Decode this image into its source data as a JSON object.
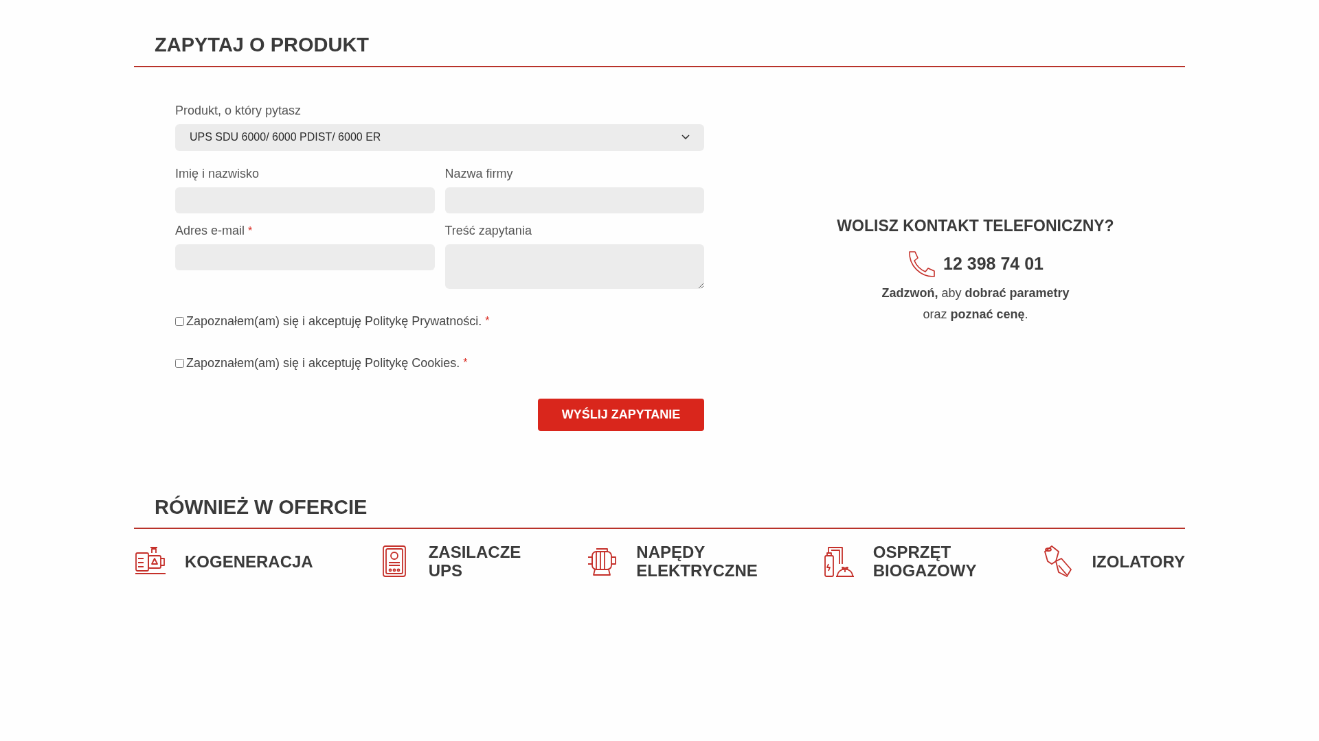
{
  "inquiry": {
    "title": "ZAPYTAJ O PRODUKT",
    "product_select": {
      "label": "Produkt, o który pytasz",
      "value": "UPS SDU 6000/ 6000 PDIST/ 6000 ER"
    },
    "fields": [
      {
        "kind": "input",
        "label": "Imię i nazwisko",
        "required": false
      },
      {
        "kind": "input",
        "label": "Nazwa firmy",
        "required": false
      },
      {
        "kind": "input",
        "label": "Adres e-mail",
        "required": true
      },
      {
        "kind": "textarea",
        "label": "Treść zapytania",
        "required": false
      }
    ],
    "required_mark": "*",
    "consents": [
      {
        "label": "Zapoznałem(am) się i akceptuję Politykę Prywatności.",
        "checked": false,
        "required": true
      },
      {
        "label": "Zapoznałem(am) się i akceptuję Politykę Cookies.",
        "checked": false,
        "required": true
      }
    ],
    "submit_button": "WYŚLIJ ZAPYTANIE"
  },
  "phone_contact": {
    "heading": "WOLISZ KONTAKT TELEFONICZNY?",
    "phone": "12 398 74 01",
    "lines": [
      "**Zadzwoń,** aby **dobrać parametry**",
      "oraz **poznać cenę**."
    ]
  },
  "offer": {
    "title": "RÓWNIEŻ W OFERCIE",
    "items": [
      {
        "kind": "generator",
        "label_lines": [
          "KOGENERACJA"
        ]
      },
      {
        "kind": "ups",
        "label_lines": [
          "ZASILACZE",
          "UPS"
        ]
      },
      {
        "kind": "motor",
        "label_lines": [
          "NAPĘDY",
          "ELEKTRYCZNE"
        ]
      },
      {
        "kind": "biogas",
        "label_lines": [
          "OSPRZĘT",
          "BIOGAZOWY"
        ]
      },
      {
        "kind": "insulator",
        "label_lines": [
          "IZOLATORY"
        ]
      }
    ]
  }
}
